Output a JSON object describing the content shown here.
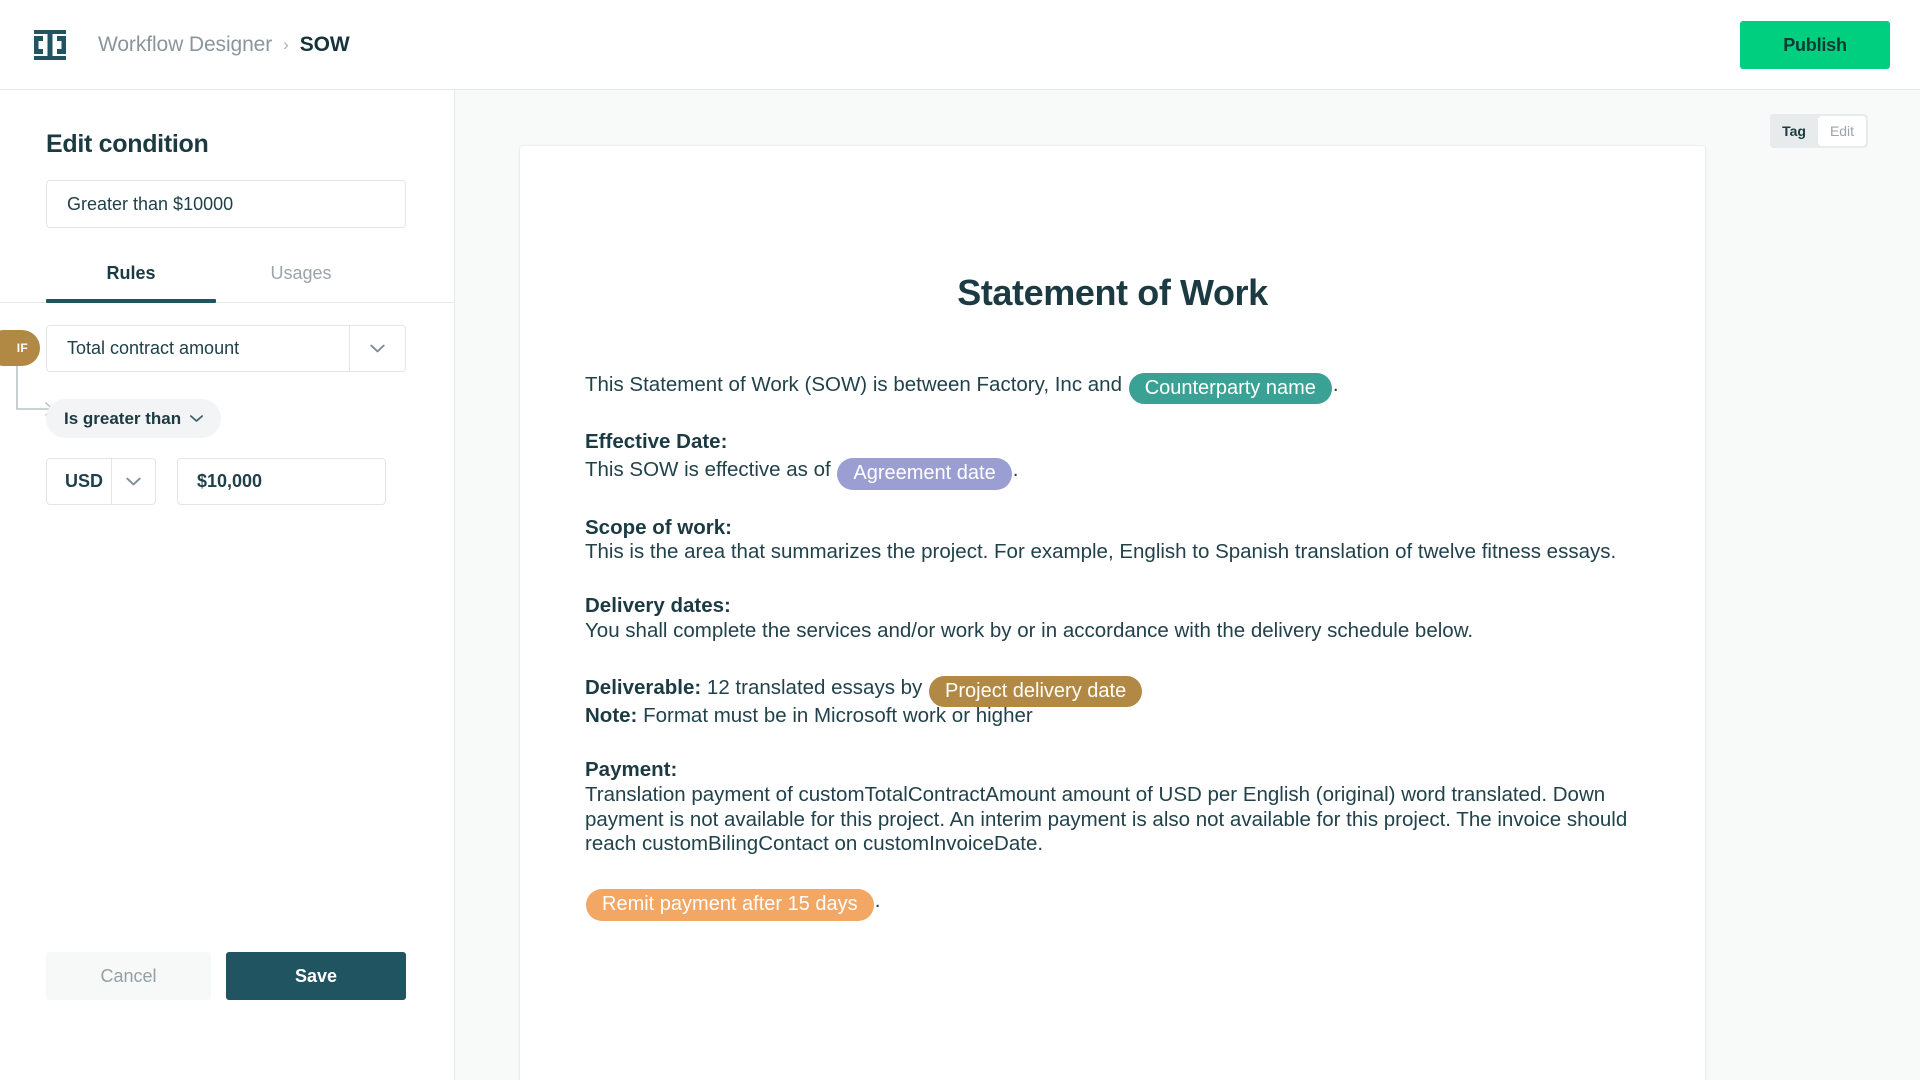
{
  "topbar": {
    "logo_name": "factory-logo",
    "breadcrumb": {
      "parent": "Workflow Designer",
      "separator": "›",
      "current": "SOW"
    },
    "publish_label": "Publish",
    "publish_color": "#00cf7f"
  },
  "left_panel": {
    "title": "Edit condition",
    "condition_name": {
      "value": "Greater than $10000",
      "placeholder": "Condition name"
    },
    "tabs": [
      {
        "label": "Rules",
        "active": true
      },
      {
        "label": "Usages",
        "active": false
      }
    ],
    "rule": {
      "if_badge": "IF",
      "field": "Total contract amount",
      "operator": "Is greater than",
      "currency": "USD",
      "amount": "$10,000",
      "amount_placeholder": "Amount"
    },
    "cancel_label": "Cancel",
    "save_label": "Save",
    "accent_color": "#1f5460",
    "if_badge_color": "#b18944"
  },
  "canvas": {
    "mode_toggle": [
      {
        "label": "Tag",
        "active": true
      },
      {
        "label": "Edit",
        "active": false
      }
    ],
    "document": {
      "title": "Statement of Work",
      "intro": {
        "before": "This Statement of Work (SOW) is between Factory, Inc and ",
        "tag": "Counterparty name",
        "tag_color": "#3aa295",
        "after": "."
      },
      "effective_date": {
        "heading": "Effective Date:",
        "before": "This SOW is effective as of ",
        "tag": "Agreement date",
        "tag_color": "#9a9ed2",
        "after": "."
      },
      "scope_of_work": {
        "heading": "Scope of work:",
        "body": "This is the area that summarizes the project. For example, English to Spanish translation of twelve fitness essays."
      },
      "delivery_dates": {
        "heading": "Delivery dates:",
        "body": "You shall complete the services and/or work by or in accordance with the delivery schedule below."
      },
      "deliverable": {
        "heading": "Deliverable:",
        "before": " 12 translated essays by ",
        "tag": "Project delivery date",
        "tag_color": "#b18944",
        "note_heading": "Note:",
        "note_body": " Format must be in Microsoft work or higher"
      },
      "payment": {
        "heading": "Payment:",
        "body": "Translation payment of customTotalContractAmount amount of USD per English (original) word translated. Down payment is not available for this project. An interim payment is also not available for this project. The invoice should reach customBilingContact on customInvoiceDate."
      },
      "remit": {
        "tag": "Remit payment after 15 days",
        "tag_color": "#f3a764",
        "after": "."
      }
    }
  }
}
